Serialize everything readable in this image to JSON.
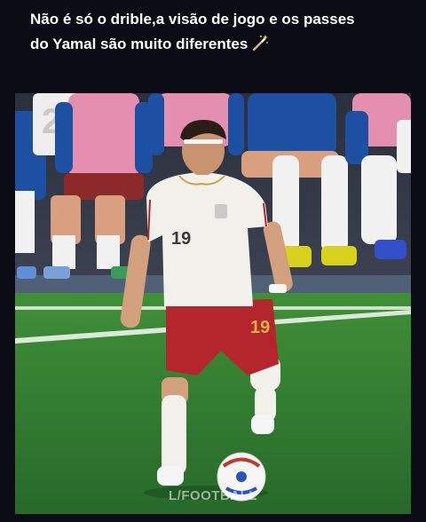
{
  "post": {
    "caption_line1": "Não é só o drible,a visão de jogo e os passes",
    "caption_line2": "do Yamal são muito diferentes",
    "caption_emoji": "magic-wand-icon"
  },
  "video": {
    "player_number": "19",
    "shorts_number": "19",
    "bench_number": "2",
    "watermark": "L/FOOTBALL"
  },
  "colors": {
    "background": "#0b0b16",
    "pitch": "#2f7a2c",
    "jersey": "#f2f0ea",
    "shorts": "#b3262c",
    "bench_bib": "#e58fb0",
    "bench_kit": "#1d4fa3",
    "boots": "#d8d11e"
  }
}
